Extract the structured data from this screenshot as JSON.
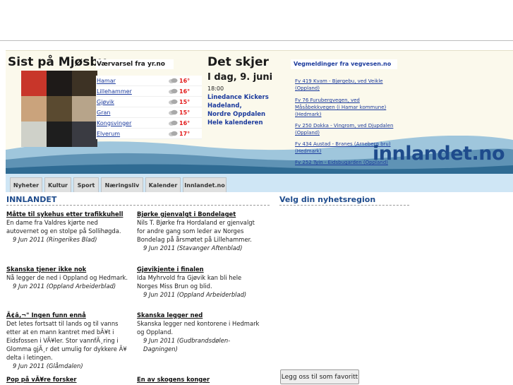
{
  "mjosby": {
    "title": "Sist på Mjøsby",
    "weather_header": "Værvarsel fra yr.no",
    "photo_colors": [
      "#c8362a",
      "#1e1a18",
      "#3d3224",
      "#caa37c",
      "#5a4a30",
      "#b7a48a",
      "#cfd1c9",
      "#1e1e1e",
      "#3a3b42"
    ],
    "weather": [
      {
        "city": "Hamar",
        "temp": "16°",
        "icon": "partly-cloudy-icon"
      },
      {
        "city": "Lillehammer",
        "temp": "16°",
        "icon": "partly-cloudy-icon"
      },
      {
        "city": "Gjøvik",
        "temp": "15°",
        "icon": "partly-cloudy-icon"
      },
      {
        "city": "Gran",
        "temp": "15°",
        "icon": "partly-cloudy-icon"
      },
      {
        "city": "Kongsvinger",
        "temp": "16°",
        "icon": "partly-cloudy-icon"
      },
      {
        "city": "Elverum",
        "temp": "17°",
        "icon": "partly-cloudy-icon"
      }
    ]
  },
  "events": {
    "title": "Det skjer",
    "date": "I dag, 9. juni",
    "time": "18:00",
    "items": [
      "Linedance Kickers",
      "Hadeland,",
      "Nordre Oppdalen",
      "Hele kalenderen"
    ]
  },
  "roads": {
    "title": "Vegmeldinger fra vegvesen.no",
    "items": [
      "Fv 419 Kvam - Bjørgebu, ved Veikle (Oppland)",
      "Fv 76 Furubergvegen, ved Måsåbekkvegen (i Hamar kommune) (Hedmark)",
      "Fv 250 Dokka - Vingrom, ved Djupdalen (Oppland)",
      "Fv 434 Austad - Branes (Arneberg bru) (Hedmark)",
      "Fv 252 Tyin - Eidsbugarden (Oppland)"
    ]
  },
  "brand": "innlandet.no",
  "tabs": [
    "Nyheter",
    "Kultur",
    "Sport",
    "Næringsliv",
    "Kalender",
    "Innlandet.no"
  ],
  "section_title": "INNLANDET",
  "region_title": "Velg din nyhetsregion",
  "news": [
    {
      "title": "Måtte til sykehus etter trafikkuhell",
      "body": "En dame fra Valdres kjørte ned autovernet og en stolpe på Sollihøgda.",
      "date": "9 Jun 2011 (Ringerikes Blad)"
    },
    {
      "title": "Bjørke gjenvalgt i Bondelaget",
      "body": "Nils T. Bjørke fra Hordaland er gjenvalgt for andre gang som leder av Norges Bondelag på årsmøtet på Lillehammer.",
      "date": "9 Jun 2011 (Stavanger Aftenblad)"
    },
    {
      "title": "Skanska tjener ikke nok",
      "body": "Nå legger de ned i Oppland og Hedmark.",
      "date": "9 Jun 2011 (Oppland Arbeiderblad)"
    },
    {
      "title": "Gjøvikjente i finalen",
      "body": "Ida Myhrvold fra Gjøvik kan bli hele Norges Miss Brun og blid.",
      "date": "9 Jun 2011 (Oppland Arbeiderblad)"
    },
    {
      "title": "Ã¢â‚¬\" Ingen funn ennå",
      "body": "Det letes fortsatt til lands og til vanns etter at en mann kantret med bÃ¥t i Eidsfossen i VÃ¥ler. Stor vannfÃ¸ring i Glomma gjÃ¸r det umulig for dykkere Ã¥ delta i letingen.",
      "date": "9 Jun 2011 (Glåmdalen)"
    },
    {
      "title": "Skanska legger ned",
      "body": "Skanska legger ned kontorene i Hedmark og Oppland.",
      "date": "9 Jun 2011 (Gudbrandsdølen-Dagningen)"
    },
    {
      "title": "Pop på vÃ¥re forsker",
      "body": "",
      "date": ""
    },
    {
      "title": "En av skogens konger",
      "body": "",
      "date": ""
    }
  ],
  "favorite_button": "Legg oss til som favoritt",
  "colors": {
    "link": "#1b3a9c",
    "brand": "#1e4b8c",
    "temp": "#e21b1b",
    "banner_bg": "#fbf9ec",
    "tabs_bg": "#cfe6f5"
  }
}
